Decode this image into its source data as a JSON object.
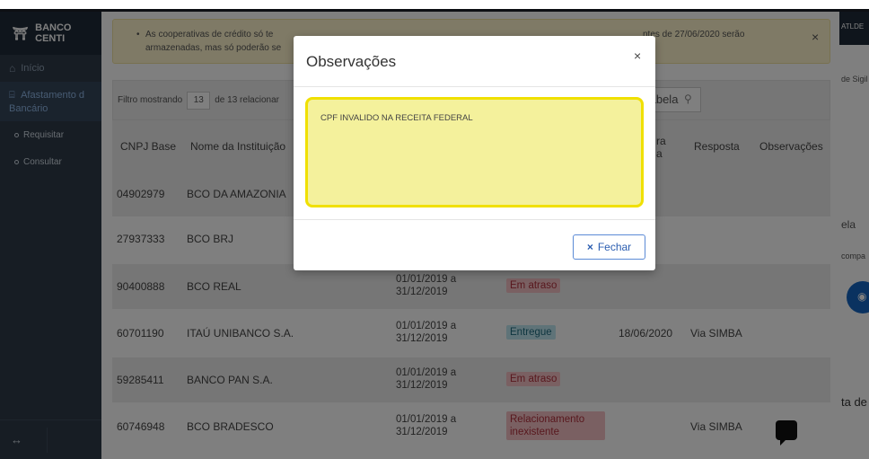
{
  "app": {
    "logo_text": "BANCO CENTI"
  },
  "sidebar": {
    "home": "Início",
    "section": "Afastamento do Bancário",
    "section_line1": "Afastamento d",
    "section_line2": "Bancário",
    "items": [
      {
        "label": "Requisitar"
      },
      {
        "label": "Consultar"
      }
    ]
  },
  "alert": {
    "line1": "As cooperativas de crédito só te",
    "line2": "armazenadas, mas só poderão se",
    "right": "ntes de 27/06/2020 serão"
  },
  "filter": {
    "prefix": "Filtro mostrando",
    "count": "13",
    "suffix": "de 13 relacionar",
    "search_placeholder": "tabela"
  },
  "table": {
    "headers": {
      "cnpj": "CNPJ Base",
      "nome": "Nome da Instituição",
      "data_line1": "ra",
      "data_line2": "a",
      "resposta": "Resposta",
      "observacoes": "Observações"
    },
    "rows": [
      {
        "cnpj": "04902979",
        "nome": "BCO DA AMAZONIA",
        "periodo1": "",
        "periodo2": "",
        "status": "",
        "data": "",
        "resposta": ""
      },
      {
        "cnpj": "27937333",
        "nome": "BCO BRJ",
        "periodo1": "",
        "periodo2": "",
        "status": "",
        "data": "",
        "resposta": ""
      },
      {
        "cnpj": "90400888",
        "nome": "BCO REAL",
        "periodo1": "01/01/2019 a",
        "periodo2": "31/12/2019",
        "status": "Em atraso",
        "data": "",
        "resposta": ""
      },
      {
        "cnpj": "60701190",
        "nome": "ITAÚ UNIBANCO S.A.",
        "periodo1": "01/01/2019 a",
        "periodo2": "31/12/2019",
        "status": "Entregue",
        "data": "18/06/2020",
        "resposta": "Via SIMBA"
      },
      {
        "cnpj": "59285411",
        "nome": "BANCO PAN S.A.",
        "periodo1": "01/01/2019 a",
        "periodo2": "31/12/2019",
        "status": "Em atraso",
        "data": "",
        "resposta": ""
      },
      {
        "cnpj": "60746948",
        "nome": "BCO BRADESCO",
        "periodo1": "01/01/2019 a",
        "periodo2": "31/12/2019",
        "status_line1": "Relacionamento",
        "status_line2": "inexistente",
        "data": "",
        "resposta": "Via SIMBA"
      }
    ]
  },
  "right_panel": {
    "top": "ATLDE",
    "sig": "de Sigil",
    "ela": "ela",
    "comp": "compa",
    "ta": "ta de"
  },
  "modal": {
    "title": "Observações",
    "close_symbol": "×",
    "observation": "CPF INVALIDO NA RECEITA FEDERAL",
    "close_button": "Fechar",
    "close_button_icon": "×"
  },
  "colors": {
    "sidebar": "#2e3a48",
    "highlight_border": "#f0e000",
    "highlight_fill": "#f4f19c",
    "accent": "#2a5db0"
  }
}
